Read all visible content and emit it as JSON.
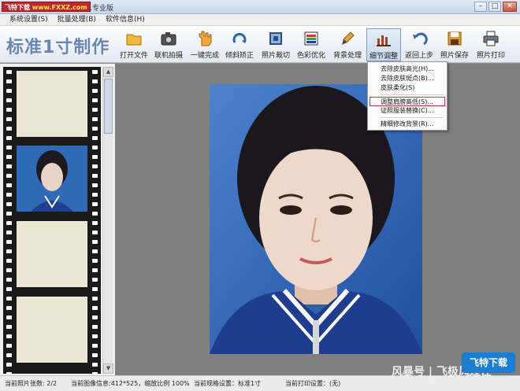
{
  "window": {
    "watermark_prefix": "飞特下载",
    "watermark_url": "www.FXXZ.com",
    "title": "…专业版"
  },
  "menu": [
    {
      "label": "系统设置(S)"
    },
    {
      "label": "批量处理(B)"
    },
    {
      "label": "软件信息(H)"
    }
  ],
  "toolbar": {
    "app_title": "标准1寸制作",
    "tools": [
      {
        "label": "打开文件",
        "icon": "folder-icon"
      },
      {
        "label": "联机拍摄",
        "icon": "camera-icon"
      },
      {
        "label": "一键完成",
        "icon": "hand-icon"
      },
      {
        "label": "倾斜矫正",
        "icon": "rotate-icon"
      },
      {
        "label": "照片裁切",
        "icon": "crop-icon"
      },
      {
        "label": "色彩优化",
        "icon": "color-icon"
      },
      {
        "label": "背景处理",
        "icon": "brush-icon"
      },
      {
        "label": "细节调整",
        "icon": "detail-icon"
      },
      {
        "label": "返回上步",
        "icon": "undo-icon"
      },
      {
        "label": "照片保存",
        "icon": "save-icon"
      },
      {
        "label": "照片打印",
        "icon": "printer-icon"
      }
    ]
  },
  "dropdown": {
    "items": [
      {
        "label": "去除皮肤高光(H)..."
      },
      {
        "label": "去除皮肤斑点(B)..."
      },
      {
        "label": "皮肤柔化(S)"
      },
      {
        "label": "调整肩膀高低(S)..."
      },
      {
        "label": "证照服装替换(C)..."
      },
      {
        "label": "精细修改背景(R)..."
      }
    ]
  },
  "status": {
    "count": "当前照片张数: 2/2",
    "info": "当前图像信息:412*525，缩放比例 100%",
    "spec": "当前规格设置：标准1寸",
    "print": "当前打印设置：(无)"
  },
  "watermarks": {
    "bottom_text": "风暴号 | 飞极风过往",
    "badge": "飞特下载"
  },
  "colors": {
    "accent": "#6a87b2",
    "photo_bg": "#2d63b2",
    "highlight": "#c63b3b"
  }
}
